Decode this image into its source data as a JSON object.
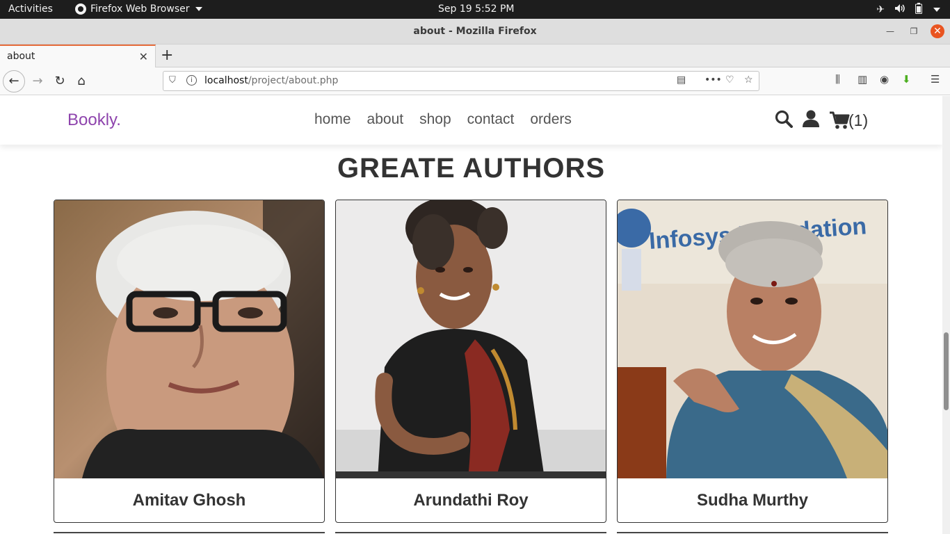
{
  "os_bar": {
    "activities": "Activities",
    "app_name": "Firefox Web Browser",
    "clock": "Sep 19  5:52 PM"
  },
  "window": {
    "title": "about - Mozilla Firefox"
  },
  "tabs": [
    {
      "label": "about",
      "active": true
    }
  ],
  "urlbar": {
    "host": "localhost",
    "path": "/project/about.php"
  },
  "site": {
    "logo": "Bookly.",
    "brand_color": "#8e44ad",
    "nav": [
      "home",
      "about",
      "shop",
      "contact",
      "orders"
    ],
    "cart_count": "(1)"
  },
  "section": {
    "heading": "GREATE AUTHORS"
  },
  "authors": [
    {
      "name": "Amitav Ghosh"
    },
    {
      "name": "Arundathi Roy"
    },
    {
      "name": "Sudha Murthy",
      "photo_sign_text": "Infosys Foundation"
    }
  ]
}
